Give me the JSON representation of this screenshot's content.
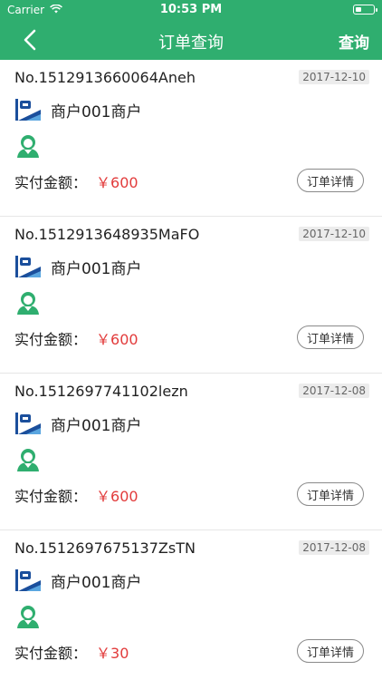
{
  "status_bar": {
    "carrier": "Carrier",
    "time": "10:53 PM"
  },
  "nav": {
    "title": "订单查询",
    "search_label": "查询"
  },
  "labels": {
    "amount_label": "实付金额：",
    "detail_button": "订单详情"
  },
  "colors": {
    "brand_green": "#2fae6f",
    "amount_red": "#e23b3b"
  },
  "orders": [
    {
      "order_no": "No.1512913660064Aneh",
      "date": "2017-12-10",
      "merchant": "商户001商户",
      "amount": "￥600"
    },
    {
      "order_no": "No.1512913648935MaFO",
      "date": "2017-12-10",
      "merchant": "商户001商户",
      "amount": "￥600"
    },
    {
      "order_no": "No.1512697741102lezn",
      "date": "2017-12-08",
      "merchant": "商户001商户",
      "amount": "￥600"
    },
    {
      "order_no": "No.1512697675137ZsTN",
      "date": "2017-12-08",
      "merchant": "商户001商户",
      "amount": "￥30"
    }
  ]
}
